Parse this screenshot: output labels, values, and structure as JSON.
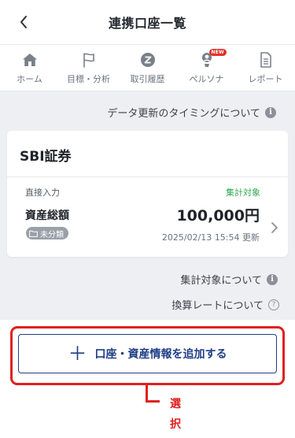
{
  "header": {
    "title": "連携口座一覧",
    "back_icon": "chevron-left-icon"
  },
  "nav": {
    "items": [
      {
        "label": "ホーム",
        "icon": "home-icon"
      },
      {
        "label": "目標・分析",
        "icon": "flag-icon"
      },
      {
        "label": "取引履歴",
        "icon": "zaim-icon"
      },
      {
        "label": "ペルソナ",
        "icon": "person-icon",
        "badge": "NEW"
      },
      {
        "label": "レポート",
        "icon": "document-icon"
      }
    ]
  },
  "timing_link": {
    "label": "データ更新のタイミングについて",
    "icon": "info-icon"
  },
  "account": {
    "name": "SBI証券",
    "input_type": "直接入力",
    "aggregation_status": "集計対象",
    "asset_label": "資産総額",
    "amount": "100,000円",
    "category": "未分類",
    "updated": "2025/02/13 15:54 更新"
  },
  "aggregation_link": {
    "label": "集計対象について",
    "icon": "info-icon"
  },
  "rate_link": {
    "label": "換算レートについて",
    "icon": "help-icon"
  },
  "add_button": {
    "label": "口座・資産情報を追加する",
    "icon": "plus-icon"
  },
  "annotation": {
    "text": "選択"
  },
  "colors": {
    "accent": "#1f3e87",
    "highlight": "#e0201c",
    "status_green": "#2fa84f",
    "background": "#eeeff2"
  }
}
